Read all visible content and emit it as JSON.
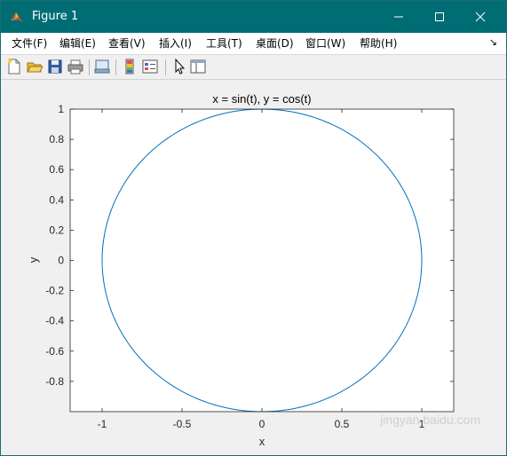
{
  "window": {
    "title": "Figure 1",
    "controls": {
      "minimize": "minimize",
      "maximize": "maximize",
      "close": "close"
    }
  },
  "menubar": {
    "items": [
      "文件(F)",
      "编辑(E)",
      "查看(V)",
      "插入(I)",
      "工具(T)",
      "桌面(D)",
      "窗口(W)",
      "帮助(H)"
    ]
  },
  "toolbar": {
    "icons": [
      "new-figure-icon",
      "open-file-icon",
      "save-icon",
      "print-icon",
      "link-icon",
      "colorbar-icon",
      "legend-icon",
      "pointer-icon",
      "property-editor-icon"
    ]
  },
  "chart_data": {
    "type": "line",
    "title": "x = sin(t), y = cos(t)",
    "xlabel": "x",
    "ylabel": "y",
    "xlim": [
      -1.2,
      1.2
    ],
    "ylim": [
      -1,
      1
    ],
    "xticks": [
      "-1",
      "-0.5",
      "0",
      "0.5",
      "1"
    ],
    "xtick_values": [
      -1,
      -0.5,
      0,
      0.5,
      1
    ],
    "yticks": [
      "1",
      "0.8",
      "0.6",
      "0.4",
      "0.2",
      "0",
      "-0.2",
      "-0.4",
      "-0.6",
      "-0.8"
    ],
    "ytick_values": [
      1,
      0.8,
      0.6,
      0.4,
      0.2,
      0,
      -0.2,
      -0.4,
      -0.6,
      -0.8
    ],
    "grid": false,
    "line_color": "#0072bd",
    "series": [
      {
        "equation_x": "sin(t)",
        "equation_y": "cos(t)",
        "t_range": [
          0,
          6.283
        ]
      }
    ]
  },
  "watermark": "jingyan.baidu.com"
}
